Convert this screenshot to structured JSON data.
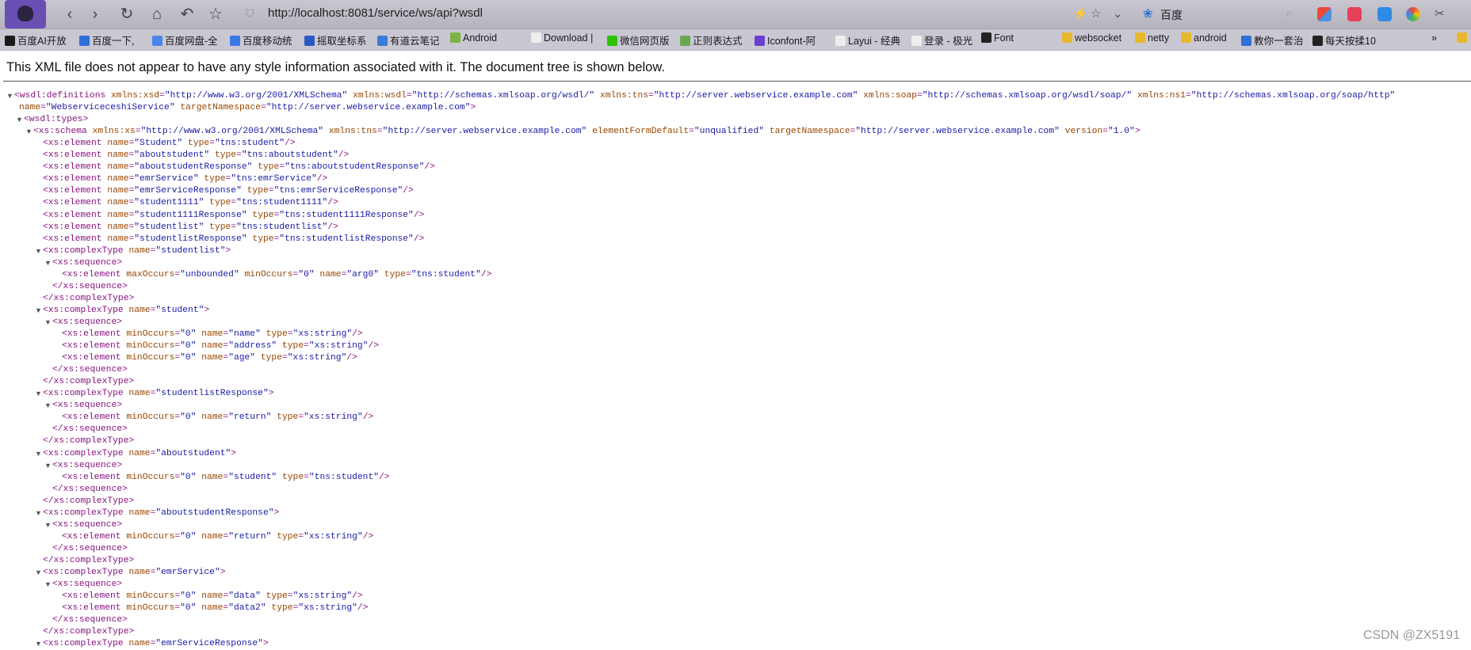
{
  "browser": {
    "url": "http://localhost:8081/service/ws/api?wsdl",
    "search_engine": "百度"
  },
  "bookmarks": [
    {
      "label": "百度AI开放",
      "color": "#1a1a1a"
    },
    {
      "label": "百度一下,",
      "color": "#2f6fd8"
    },
    {
      "label": "百度网盘-全",
      "color": "#4a86e8"
    },
    {
      "label": "百度移动统",
      "color": "#3b78e7"
    },
    {
      "label": "摇取坐标系",
      "color": "#2a59c4"
    },
    {
      "label": "有道云笔记",
      "color": "#3a7bd5"
    },
    {
      "label": "Android",
      "color": "#7cb342"
    },
    {
      "label": "Download |",
      "color": "#eeeeee"
    },
    {
      "label": "微信网页版",
      "color": "#2dc100"
    },
    {
      "label": "正则表达式",
      "color": "#6aa84f"
    },
    {
      "label": "Iconfont-阿",
      "color": "#6a3fd0"
    },
    {
      "label": "Layui - 经典",
      "color": "#eeeeee"
    },
    {
      "label": "登录 - 极光",
      "color": "#eeeeee"
    },
    {
      "label": "Font",
      "color": "#222222"
    },
    {
      "label": "websocket",
      "color": "#e8b82c"
    },
    {
      "label": "netty",
      "color": "#e8b82c"
    },
    {
      "label": "android",
      "color": "#e8b82c"
    },
    {
      "label": "教你一套治",
      "color": "#2f6fd8"
    },
    {
      "label": "每天按揉10",
      "color": "#222222"
    }
  ],
  "notice": "This XML file does not appear to have any style information associated with it. The document tree is shown below.",
  "xml_lines": [
    [
      {
        "t": "tg",
        "v": "<wsdl:definitions "
      },
      {
        "t": "an",
        "v": "xmlns:xsd"
      },
      {
        "t": "tg",
        "v": "="
      },
      {
        "t": "av",
        "v": "\"http://www.w3.org/2001/XMLSchema\""
      },
      {
        "t": "an",
        "v": " xmlns:wsdl"
      },
      {
        "t": "tg",
        "v": "="
      },
      {
        "t": "av",
        "v": "\"http://schemas.xmlsoap.org/wsdl/\""
      },
      {
        "t": "an",
        "v": " xmlns:tns"
      },
      {
        "t": "tg",
        "v": "="
      },
      {
        "t": "av",
        "v": "\"http://server.webservice.example.com\""
      },
      {
        "t": "an",
        "v": " xmlns:soap"
      },
      {
        "t": "tg",
        "v": "="
      },
      {
        "t": "av",
        "v": "\"http://schemas.xmlsoap.org/wsdl/soap/\""
      },
      {
        "t": "an",
        "v": " xmlns:ns1"
      },
      {
        "t": "tg",
        "v": "="
      },
      {
        "t": "av",
        "v": "\"http://schemas.xmlsoap.org/soap/http\""
      }
    ],
    [
      {
        "t": "an",
        "v": "name"
      },
      {
        "t": "tg",
        "v": "="
      },
      {
        "t": "av",
        "v": "\"WebserviceceshiService\""
      },
      {
        "t": "an",
        "v": " targetNamespace"
      },
      {
        "t": "tg",
        "v": "="
      },
      {
        "t": "av",
        "v": "\"http://server.webservice.example.com\""
      },
      {
        "t": "tg",
        "v": ">"
      }
    ],
    [
      {
        "t": "tg",
        "v": "<wsdl:types>"
      }
    ],
    [
      {
        "t": "tg",
        "v": "<xs:schema "
      },
      {
        "t": "an",
        "v": "xmlns:xs"
      },
      {
        "t": "tg",
        "v": "="
      },
      {
        "t": "av",
        "v": "\"http://www.w3.org/2001/XMLSchema\""
      },
      {
        "t": "an",
        "v": " xmlns:tns"
      },
      {
        "t": "tg",
        "v": "="
      },
      {
        "t": "av",
        "v": "\"http://server.webservice.example.com\""
      },
      {
        "t": "an",
        "v": " elementFormDefault"
      },
      {
        "t": "tg",
        "v": "="
      },
      {
        "t": "av",
        "v": "\"unqualified\""
      },
      {
        "t": "an",
        "v": " targetNamespace"
      },
      {
        "t": "tg",
        "v": "="
      },
      {
        "t": "av",
        "v": "\"http://server.webservice.example.com\""
      },
      {
        "t": "an",
        "v": " version"
      },
      {
        "t": "tg",
        "v": "="
      },
      {
        "t": "av",
        "v": "\"1.0\""
      },
      {
        "t": "tg",
        "v": ">"
      }
    ],
    [
      {
        "t": "tg",
        "v": "<xs:element "
      },
      {
        "t": "an",
        "v": "name"
      },
      {
        "t": "tg",
        "v": "="
      },
      {
        "t": "av",
        "v": "\"Student\""
      },
      {
        "t": "an",
        "v": " type"
      },
      {
        "t": "tg",
        "v": "="
      },
      {
        "t": "av",
        "v": "\"tns:student\""
      },
      {
        "t": "tg",
        "v": "/>"
      }
    ],
    [
      {
        "t": "tg",
        "v": "<xs:element "
      },
      {
        "t": "an",
        "v": "name"
      },
      {
        "t": "tg",
        "v": "="
      },
      {
        "t": "av",
        "v": "\"aboutstudent\""
      },
      {
        "t": "an",
        "v": " type"
      },
      {
        "t": "tg",
        "v": "="
      },
      {
        "t": "av",
        "v": "\"tns:aboutstudent\""
      },
      {
        "t": "tg",
        "v": "/>"
      }
    ],
    [
      {
        "t": "tg",
        "v": "<xs:element "
      },
      {
        "t": "an",
        "v": "name"
      },
      {
        "t": "tg",
        "v": "="
      },
      {
        "t": "av",
        "v": "\"aboutstudentResponse\""
      },
      {
        "t": "an",
        "v": " type"
      },
      {
        "t": "tg",
        "v": "="
      },
      {
        "t": "av",
        "v": "\"tns:aboutstudentResponse\""
      },
      {
        "t": "tg",
        "v": "/>"
      }
    ],
    [
      {
        "t": "tg",
        "v": "<xs:element "
      },
      {
        "t": "an",
        "v": "name"
      },
      {
        "t": "tg",
        "v": "="
      },
      {
        "t": "av",
        "v": "\"emrService\""
      },
      {
        "t": "an",
        "v": " type"
      },
      {
        "t": "tg",
        "v": "="
      },
      {
        "t": "av",
        "v": "\"tns:emrService\""
      },
      {
        "t": "tg",
        "v": "/>"
      }
    ],
    [
      {
        "t": "tg",
        "v": "<xs:element "
      },
      {
        "t": "an",
        "v": "name"
      },
      {
        "t": "tg",
        "v": "="
      },
      {
        "t": "av",
        "v": "\"emrServiceResponse\""
      },
      {
        "t": "an",
        "v": " type"
      },
      {
        "t": "tg",
        "v": "="
      },
      {
        "t": "av",
        "v": "\"tns:emrServiceResponse\""
      },
      {
        "t": "tg",
        "v": "/>"
      }
    ],
    [
      {
        "t": "tg",
        "v": "<xs:element "
      },
      {
        "t": "an",
        "v": "name"
      },
      {
        "t": "tg",
        "v": "="
      },
      {
        "t": "av",
        "v": "\"student1111\""
      },
      {
        "t": "an",
        "v": " type"
      },
      {
        "t": "tg",
        "v": "="
      },
      {
        "t": "av",
        "v": "\"tns:student1111\""
      },
      {
        "t": "tg",
        "v": "/>"
      }
    ],
    [
      {
        "t": "tg",
        "v": "<xs:element "
      },
      {
        "t": "an",
        "v": "name"
      },
      {
        "t": "tg",
        "v": "="
      },
      {
        "t": "av",
        "v": "\"student1111Response\""
      },
      {
        "t": "an",
        "v": " type"
      },
      {
        "t": "tg",
        "v": "="
      },
      {
        "t": "av",
        "v": "\"tns:student1111Response\""
      },
      {
        "t": "tg",
        "v": "/>"
      }
    ],
    [
      {
        "t": "tg",
        "v": "<xs:element "
      },
      {
        "t": "an",
        "v": "name"
      },
      {
        "t": "tg",
        "v": "="
      },
      {
        "t": "av",
        "v": "\"studentlist\""
      },
      {
        "t": "an",
        "v": " type"
      },
      {
        "t": "tg",
        "v": "="
      },
      {
        "t": "av",
        "v": "\"tns:studentlist\""
      },
      {
        "t": "tg",
        "v": "/>"
      }
    ],
    [
      {
        "t": "tg",
        "v": "<xs:element "
      },
      {
        "t": "an",
        "v": "name"
      },
      {
        "t": "tg",
        "v": "="
      },
      {
        "t": "av",
        "v": "\"studentlistResponse\""
      },
      {
        "t": "an",
        "v": " type"
      },
      {
        "t": "tg",
        "v": "="
      },
      {
        "t": "av",
        "v": "\"tns:studentlistResponse\""
      },
      {
        "t": "tg",
        "v": "/>"
      }
    ],
    [
      {
        "t": "tg",
        "v": "<xs:complexType "
      },
      {
        "t": "an",
        "v": "name"
      },
      {
        "t": "tg",
        "v": "="
      },
      {
        "t": "av",
        "v": "\"studentlist\""
      },
      {
        "t": "tg",
        "v": ">"
      }
    ],
    [
      {
        "t": "tg",
        "v": "<xs:sequence>"
      }
    ],
    [
      {
        "t": "tg",
        "v": "<xs:element "
      },
      {
        "t": "an",
        "v": "maxOccurs"
      },
      {
        "t": "tg",
        "v": "="
      },
      {
        "t": "av",
        "v": "\"unbounded\""
      },
      {
        "t": "an",
        "v": " minOccurs"
      },
      {
        "t": "tg",
        "v": "="
      },
      {
        "t": "av",
        "v": "\"0\""
      },
      {
        "t": "an",
        "v": " name"
      },
      {
        "t": "tg",
        "v": "="
      },
      {
        "t": "av",
        "v": "\"arg0\""
      },
      {
        "t": "an",
        "v": " type"
      },
      {
        "t": "tg",
        "v": "="
      },
      {
        "t": "av",
        "v": "\"tns:student\""
      },
      {
        "t": "tg",
        "v": "/>"
      }
    ],
    [
      {
        "t": "tg",
        "v": "</xs:sequence>"
      }
    ],
    [
      {
        "t": "tg",
        "v": "</xs:complexType>"
      }
    ],
    [
      {
        "t": "tg",
        "v": "<xs:complexType "
      },
      {
        "t": "an",
        "v": "name"
      },
      {
        "t": "tg",
        "v": "="
      },
      {
        "t": "av",
        "v": "\"student\""
      },
      {
        "t": "tg",
        "v": ">"
      }
    ],
    [
      {
        "t": "tg",
        "v": "<xs:sequence>"
      }
    ],
    [
      {
        "t": "tg",
        "v": "<xs:element "
      },
      {
        "t": "an",
        "v": "minOccurs"
      },
      {
        "t": "tg",
        "v": "="
      },
      {
        "t": "av",
        "v": "\"0\""
      },
      {
        "t": "an",
        "v": " name"
      },
      {
        "t": "tg",
        "v": "="
      },
      {
        "t": "av",
        "v": "\"name\""
      },
      {
        "t": "an",
        "v": " type"
      },
      {
        "t": "tg",
        "v": "="
      },
      {
        "t": "av",
        "v": "\"xs:string\""
      },
      {
        "t": "tg",
        "v": "/>"
      }
    ],
    [
      {
        "t": "tg",
        "v": "<xs:element "
      },
      {
        "t": "an",
        "v": "minOccurs"
      },
      {
        "t": "tg",
        "v": "="
      },
      {
        "t": "av",
        "v": "\"0\""
      },
      {
        "t": "an",
        "v": " name"
      },
      {
        "t": "tg",
        "v": "="
      },
      {
        "t": "av",
        "v": "\"address\""
      },
      {
        "t": "an",
        "v": " type"
      },
      {
        "t": "tg",
        "v": "="
      },
      {
        "t": "av",
        "v": "\"xs:string\""
      },
      {
        "t": "tg",
        "v": "/>"
      }
    ],
    [
      {
        "t": "tg",
        "v": "<xs:element "
      },
      {
        "t": "an",
        "v": "minOccurs"
      },
      {
        "t": "tg",
        "v": "="
      },
      {
        "t": "av",
        "v": "\"0\""
      },
      {
        "t": "an",
        "v": " name"
      },
      {
        "t": "tg",
        "v": "="
      },
      {
        "t": "av",
        "v": "\"age\""
      },
      {
        "t": "an",
        "v": " type"
      },
      {
        "t": "tg",
        "v": "="
      },
      {
        "t": "av",
        "v": "\"xs:string\""
      },
      {
        "t": "tg",
        "v": "/>"
      }
    ],
    [
      {
        "t": "tg",
        "v": "</xs:sequence>"
      }
    ],
    [
      {
        "t": "tg",
        "v": "</xs:complexType>"
      }
    ],
    [
      {
        "t": "tg",
        "v": "<xs:complexType "
      },
      {
        "t": "an",
        "v": "name"
      },
      {
        "t": "tg",
        "v": "="
      },
      {
        "t": "av",
        "v": "\"studentlistResponse\""
      },
      {
        "t": "tg",
        "v": ">"
      }
    ],
    [
      {
        "t": "tg",
        "v": "<xs:sequence>"
      }
    ],
    [
      {
        "t": "tg",
        "v": "<xs:element "
      },
      {
        "t": "an",
        "v": "minOccurs"
      },
      {
        "t": "tg",
        "v": "="
      },
      {
        "t": "av",
        "v": "\"0\""
      },
      {
        "t": "an",
        "v": " name"
      },
      {
        "t": "tg",
        "v": "="
      },
      {
        "t": "av",
        "v": "\"return\""
      },
      {
        "t": "an",
        "v": " type"
      },
      {
        "t": "tg",
        "v": "="
      },
      {
        "t": "av",
        "v": "\"xs:string\""
      },
      {
        "t": "tg",
        "v": "/>"
      }
    ],
    [
      {
        "t": "tg",
        "v": "</xs:sequence>"
      }
    ],
    [
      {
        "t": "tg",
        "v": "</xs:complexType>"
      }
    ],
    [
      {
        "t": "tg",
        "v": "<xs:complexType "
      },
      {
        "t": "an",
        "v": "name"
      },
      {
        "t": "tg",
        "v": "="
      },
      {
        "t": "av",
        "v": "\"aboutstudent\""
      },
      {
        "t": "tg",
        "v": ">"
      }
    ],
    [
      {
        "t": "tg",
        "v": "<xs:sequence>"
      }
    ],
    [
      {
        "t": "tg",
        "v": "<xs:element "
      },
      {
        "t": "an",
        "v": "minOccurs"
      },
      {
        "t": "tg",
        "v": "="
      },
      {
        "t": "av",
        "v": "\"0\""
      },
      {
        "t": "an",
        "v": " name"
      },
      {
        "t": "tg",
        "v": "="
      },
      {
        "t": "av",
        "v": "\"student\""
      },
      {
        "t": "an",
        "v": " type"
      },
      {
        "t": "tg",
        "v": "="
      },
      {
        "t": "av",
        "v": "\"tns:student\""
      },
      {
        "t": "tg",
        "v": "/>"
      }
    ],
    [
      {
        "t": "tg",
        "v": "</xs:sequence>"
      }
    ],
    [
      {
        "t": "tg",
        "v": "</xs:complexType>"
      }
    ],
    [
      {
        "t": "tg",
        "v": "<xs:complexType "
      },
      {
        "t": "an",
        "v": "name"
      },
      {
        "t": "tg",
        "v": "="
      },
      {
        "t": "av",
        "v": "\"aboutstudentResponse\""
      },
      {
        "t": "tg",
        "v": ">"
      }
    ],
    [
      {
        "t": "tg",
        "v": "<xs:sequence>"
      }
    ],
    [
      {
        "t": "tg",
        "v": "<xs:element "
      },
      {
        "t": "an",
        "v": "minOccurs"
      },
      {
        "t": "tg",
        "v": "="
      },
      {
        "t": "av",
        "v": "\"0\""
      },
      {
        "t": "an",
        "v": " name"
      },
      {
        "t": "tg",
        "v": "="
      },
      {
        "t": "av",
        "v": "\"return\""
      },
      {
        "t": "an",
        "v": " type"
      },
      {
        "t": "tg",
        "v": "="
      },
      {
        "t": "av",
        "v": "\"xs:string\""
      },
      {
        "t": "tg",
        "v": "/>"
      }
    ],
    [
      {
        "t": "tg",
        "v": "</xs:sequence>"
      }
    ],
    [
      {
        "t": "tg",
        "v": "</xs:complexType>"
      }
    ],
    [
      {
        "t": "tg",
        "v": "<xs:complexType "
      },
      {
        "t": "an",
        "v": "name"
      },
      {
        "t": "tg",
        "v": "="
      },
      {
        "t": "av",
        "v": "\"emrService\""
      },
      {
        "t": "tg",
        "v": ">"
      }
    ],
    [
      {
        "t": "tg",
        "v": "<xs:sequence>"
      }
    ],
    [
      {
        "t": "tg",
        "v": "<xs:element "
      },
      {
        "t": "an",
        "v": "minOccurs"
      },
      {
        "t": "tg",
        "v": "="
      },
      {
        "t": "av",
        "v": "\"0\""
      },
      {
        "t": "an",
        "v": " name"
      },
      {
        "t": "tg",
        "v": "="
      },
      {
        "t": "av",
        "v": "\"data\""
      },
      {
        "t": "an",
        "v": " type"
      },
      {
        "t": "tg",
        "v": "="
      },
      {
        "t": "av",
        "v": "\"xs:string\""
      },
      {
        "t": "tg",
        "v": "/>"
      }
    ],
    [
      {
        "t": "tg",
        "v": "<xs:element "
      },
      {
        "t": "an",
        "v": "minOccurs"
      },
      {
        "t": "tg",
        "v": "="
      },
      {
        "t": "av",
        "v": "\"0\""
      },
      {
        "t": "an",
        "v": " name"
      },
      {
        "t": "tg",
        "v": "="
      },
      {
        "t": "av",
        "v": "\"data2\""
      },
      {
        "t": "an",
        "v": " type"
      },
      {
        "t": "tg",
        "v": "="
      },
      {
        "t": "av",
        "v": "\"xs:string\""
      },
      {
        "t": "tg",
        "v": "/>"
      }
    ],
    [
      {
        "t": "tg",
        "v": "</xs:sequence>"
      }
    ],
    [
      {
        "t": "tg",
        "v": "</xs:complexType>"
      }
    ],
    [
      {
        "t": "tg",
        "v": "<xs:complexType "
      },
      {
        "t": "an",
        "v": "name"
      },
      {
        "t": "tg",
        "v": "="
      },
      {
        "t": "av",
        "v": "\"emrServiceResponse\""
      },
      {
        "t": "tg",
        "v": ">"
      }
    ]
  ],
  "watermark": "CSDN @ZX5191"
}
